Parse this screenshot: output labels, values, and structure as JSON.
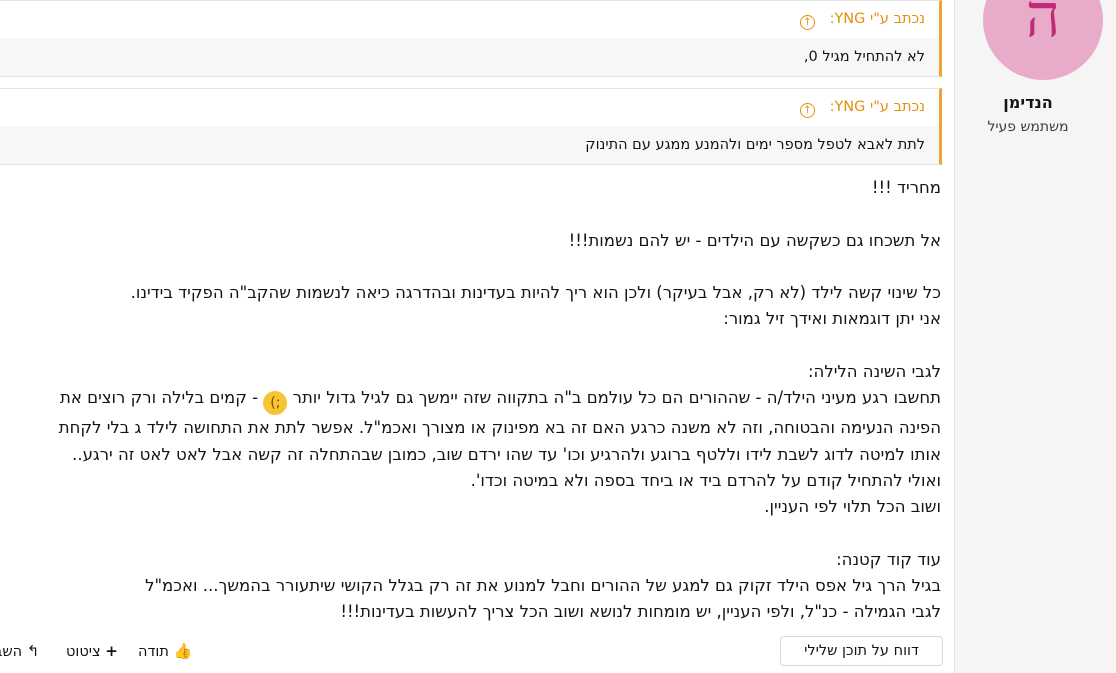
{
  "quotes": [
    {
      "author": "נכתב ע\"י YNG:",
      "text": "לא להתחיל מגיל 0,"
    },
    {
      "author": "נכתב ע\"י YNG:",
      "text": "לתת לאבא לטפל מספר ימים ולהמנע ממגע עם התינוק"
    }
  ],
  "post": {
    "l1": "מחריד !!!",
    "l2": "אל תשכחו גם כשקשה עם הילדים - יש להם נשמות!!!",
    "l3": "כל שינוי קשה לילד (לא רק, אבל בעיקר) ולכן הוא ריך להיות בעדינות ובהדרגה כיאה לנשמות שהקב\"ה הפקיד בידינו.",
    "l4": "אני יתן דוגמאות ואידך זיל גמור:",
    "l5": "לגבי השינה הלילה:",
    "l6a": "תחשבו רגע מעיני הילד/ה - שההורים הם כל עולמם ב\"ה בתקווה שזה יימשך גם לגיל גדול יותר",
    "l6b": "- קמים בלילה ורק רוצים את",
    "l7": "הפינה הנעימה והבטוחה, וזה לא משנה כרגע האם זה בא מפינוק או מצורך ואכמ\"ל. אפשר לתת את התחושה לילד ג בלי לקחת",
    "l8": "אותו למיטה לדוג לשבת לידו וללטף ברוגע ולהרגיע וכו' עד שהו ירדם שוב, כמובן שבהתחלה זה קשה אבל לאט לאט זה ירגע..",
    "l9": "ואולי להתחיל קודם על להרדם ביד או ביחד בספה ולא במיטה וכדו'.",
    "l10": "ושוב הכל תלוי לפי העניין.",
    "l11": "עוד קוד קטנה:",
    "l12": "בגיל הרך גיל אפס הילד זקוק גם למגע של ההורים וחבל למנוע את זה רק בגלל הקושי שיתעורר בהמשך... ואכמ\"ל",
    "l13": "לגבי הגמילה - כנ\"ל, ולפי העניין, יש מומחות לנושא ושוב הכל צריך להעשות בעדינות!!!"
  },
  "user": {
    "avatar_letter": "ה",
    "name": "הנדימן",
    "title": "משתמש פעיל"
  },
  "actions": {
    "report": "דווח על תוכן שלילי",
    "like": "תודה",
    "quote": "ציטוט",
    "share": "השב"
  },
  "icons": {
    "quote_arrow": "arrow-up-circle-icon",
    "like": "thumbs-up-icon",
    "quote": "plus-icon",
    "share": "reply-icon",
    "emoji": "wink-emoji-icon"
  },
  "colors": {
    "accent": "#f0a238",
    "avatar_bg": "#e8acca",
    "avatar_fg": "#bf2a7a"
  }
}
